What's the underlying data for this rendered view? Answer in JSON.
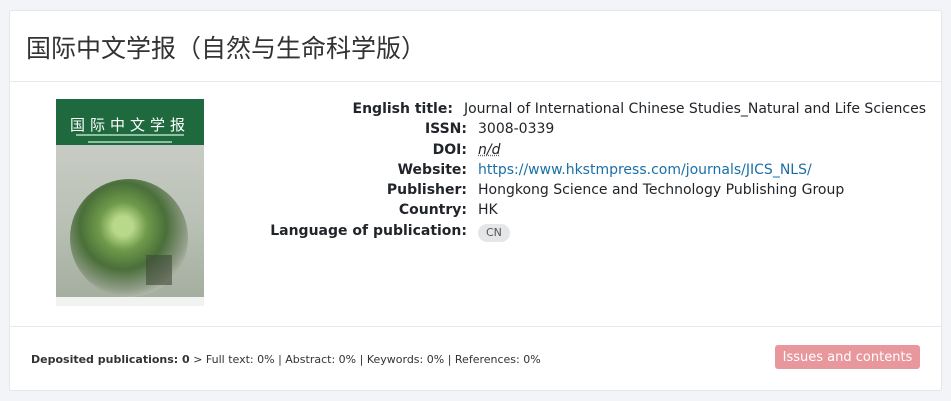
{
  "journal": {
    "title": "国际中文学报（自然与生命科学版）",
    "cover_text": "国际中文学报",
    "fields": [
      {
        "label": "English title:",
        "value": "Journal of International Chinese Studies_Natural and Life Sciences"
      },
      {
        "label": "ISSN:",
        "value": "3008-0339"
      },
      {
        "label": "DOI:",
        "value": "n/d"
      },
      {
        "label": "Website:",
        "value": "https://www.hkstmpress.com/journals/JICS_NLS/"
      },
      {
        "label": "Publisher:",
        "value": "Hongkong Science and Technology Publishing Group"
      },
      {
        "label": "Country:",
        "value": "HK"
      },
      {
        "label": "Language of publication:",
        "value": "CN"
      }
    ]
  },
  "footer": {
    "deposited_label": "Deposited publications: 0",
    "separator": ">",
    "full_text": "Full text: 0%",
    "abstract": "Abstract: 0%",
    "keywords": "Keywords: 0%",
    "references": "References: 0%",
    "issues_button": "Issues and contents"
  },
  "colors": {
    "link": "#1a6fa8",
    "button": "#e8979c",
    "cover_green": "#1e6a3e"
  }
}
